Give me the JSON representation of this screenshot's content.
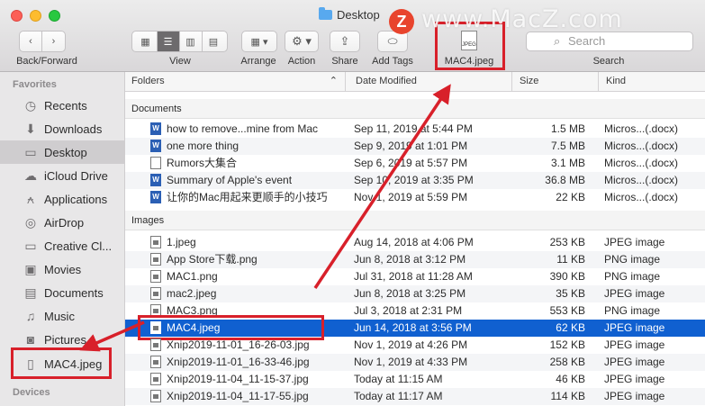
{
  "window": {
    "title": "Desktop"
  },
  "toolbar": {
    "back_forward_label": "Back/Forward",
    "view_label": "View",
    "arrange_label": "Arrange",
    "action_label": "Action",
    "share_label": "Share",
    "add_tags_label": "Add Tags",
    "dragged_item_label": "MAC4.jpeg",
    "dragged_item_badge": "JPEG",
    "search_placeholder": "Search",
    "search_label": "Search"
  },
  "watermark": {
    "badge": "Z",
    "text": "www.MacZ.com"
  },
  "sidebar": {
    "favorites_heading": "Favorites",
    "items": [
      {
        "label": "Recents",
        "icon": "clock-icon"
      },
      {
        "label": "Downloads",
        "icon": "download-icon"
      },
      {
        "label": "Desktop",
        "icon": "desktop-icon"
      },
      {
        "label": "iCloud Drive",
        "icon": "cloud-icon"
      },
      {
        "label": "Applications",
        "icon": "applications-icon"
      },
      {
        "label": "AirDrop",
        "icon": "airdrop-icon"
      },
      {
        "label": "Creative Cl...",
        "icon": "folder-icon"
      },
      {
        "label": "Movies",
        "icon": "film-icon"
      },
      {
        "label": "Documents",
        "icon": "document-icon"
      },
      {
        "label": "Music",
        "icon": "music-icon"
      },
      {
        "label": "Pictures",
        "icon": "camera-icon"
      },
      {
        "label": "MAC4.jpeg",
        "icon": "file-icon"
      }
    ],
    "devices_heading": "Devices"
  },
  "columns": {
    "name": "Folders",
    "date": "Date Modified",
    "size": "Size",
    "kind": "Kind"
  },
  "groups": {
    "documents": {
      "label": "Documents",
      "rows": [
        {
          "name": "how to remove...mine from Mac",
          "date": "Sep 11, 2019 at 5:44 PM",
          "size": "1.5 MB",
          "kind": "Micros...(.docx)"
        },
        {
          "name": "one more thing",
          "date": "Sep 9, 2019 at 1:01 PM",
          "size": "7.5 MB",
          "kind": "Micros...(.docx)"
        },
        {
          "name": "Rumors大集合",
          "date": "Sep 6, 2019 at 5:57 PM",
          "size": "3.1 MB",
          "kind": "Micros...(.docx)"
        },
        {
          "name": "Summary of Apple's event",
          "date": "Sep 10, 2019 at 3:35 PM",
          "size": "36.8 MB",
          "kind": "Micros...(.docx)"
        },
        {
          "name": "让你的Mac用起来更顺手的小技巧",
          "date": "Nov 1, 2019 at 5:59 PM",
          "size": "22 KB",
          "kind": "Micros...(.docx)"
        }
      ]
    },
    "images": {
      "label": "Images",
      "rows": [
        {
          "name": "1.jpeg",
          "date": "Aug 14, 2018 at 4:06 PM",
          "size": "253 KB",
          "kind": "JPEG image"
        },
        {
          "name": "App Store下载.png",
          "date": "Jun 8, 2018 at 3:12 PM",
          "size": "11 KB",
          "kind": "PNG image"
        },
        {
          "name": "MAC1.png",
          "date": "Jul 31, 2018 at 11:28 AM",
          "size": "390 KB",
          "kind": "PNG image"
        },
        {
          "name": "mac2.jpeg",
          "date": "Jun 8, 2018 at 3:25 PM",
          "size": "35 KB",
          "kind": "JPEG image"
        },
        {
          "name": "MAC3.png",
          "date": "Jul 3, 2018 at 2:31 PM",
          "size": "553 KB",
          "kind": "PNG image"
        },
        {
          "name": "MAC4.jpeg",
          "date": "Jun 14, 2018 at 3:56 PM",
          "size": "62 KB",
          "kind": "JPEG image"
        },
        {
          "name": "Xnip2019-11-01_16-26-03.jpg",
          "date": "Nov 1, 2019 at 4:26 PM",
          "size": "152 KB",
          "kind": "JPEG image"
        },
        {
          "name": "Xnip2019-11-01_16-33-46.jpg",
          "date": "Nov 1, 2019 at 4:33 PM",
          "size": "258 KB",
          "kind": "JPEG image"
        },
        {
          "name": "Xnip2019-11-04_11-15-37.jpg",
          "date": "Today at 11:15 AM",
          "size": "46 KB",
          "kind": "JPEG image"
        },
        {
          "name": "Xnip2019-11-04_11-17-55.jpg",
          "date": "Today at 11:17 AM",
          "size": "114 KB",
          "kind": "JPEG image"
        }
      ]
    }
  },
  "colors": {
    "selection": "#1060d0",
    "highlight": "#d8202a",
    "word_icon": "#2b5fb4"
  }
}
